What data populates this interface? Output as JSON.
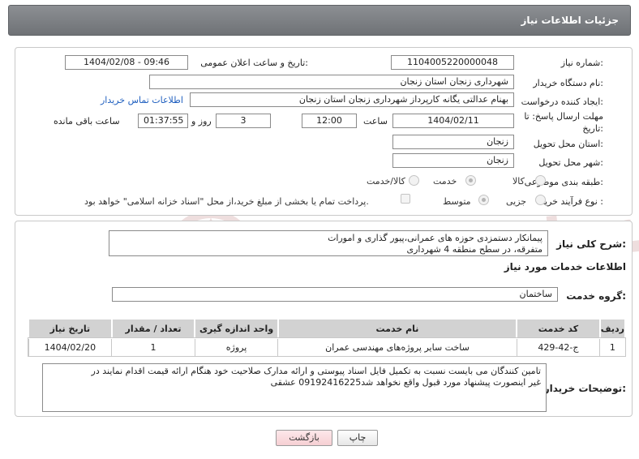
{
  "header": {
    "title": "جزئیات اطلاعات نیاز"
  },
  "watermark": {
    "brand_text": "AriaTender.neT",
    "color": "#8b1d1d"
  },
  "form": {
    "need_number": {
      "label": "شماره نیاز:",
      "value": "1104005220000048"
    },
    "announce_datetime": {
      "label": "تاریخ و ساعت اعلان عمومی:",
      "value": "1404/02/08 - 09:46"
    },
    "buyer_org": {
      "label": "نام دستگاه خریدار:",
      "value": "شهرداری زنجان استان زنجان"
    },
    "requester": {
      "label": "ایجاد کننده درخواست:",
      "value": "بهنام عدالتی یگانه کارپرداز شهرداری زنجان استان زنجان"
    },
    "contact_link": "اطلاعات تماس خریدار",
    "deadline": {
      "label_line1": "مهلت ارسال پاسخ: تا",
      "label_line2": "تاریخ:",
      "date": "1404/02/11",
      "time_label": "ساعت",
      "time": "12:00",
      "days": "3",
      "days_label": "روز و",
      "remaining": "01:37:55",
      "remaining_label": "ساعت باقی مانده"
    },
    "delivery_province": {
      "label": "استان محل تحویل:",
      "value": "زنجان"
    },
    "delivery_city": {
      "label": "شهر محل تحویل:",
      "value": "زنجان"
    },
    "category": {
      "label": "طبقه بندی موضوعی:",
      "options": [
        "کالا",
        "خدمت",
        "کالا/خدمت"
      ],
      "selected": "خدمت"
    },
    "process": {
      "label": "نوع فرآیند خرید :",
      "options": [
        "جزیی",
        "متوسط"
      ],
      "selected": "متوسط",
      "treasury_note": "پرداخت تمام یا بخشی از مبلغ خرید،از محل \"اسناد خزانه اسلامی\" خواهد بود."
    }
  },
  "details": {
    "summary": {
      "label": "شرح کلی نیاز:",
      "line1": "پیمانکار دستمزدی حوزه های عمرانی،پیور گذاری و امورات",
      "line2": "متفرقه، در سطح منطقه 4 شهرداری"
    },
    "services_heading": "اطلاعات خدمات مورد نیاز",
    "service_group": {
      "label": "گروه خدمت:",
      "value": "ساختمان"
    },
    "table": {
      "headers": [
        "ردیف",
        "کد خدمت",
        "نام خدمت",
        "واحد اندازه گیری",
        "تعداد / مقدار",
        "تاریخ نیاز"
      ],
      "rows": [
        [
          "1",
          "ج-42-429",
          "ساخت سایر پروژه‌های مهندسی عمران",
          "پروژه",
          "1",
          "1404/02/20"
        ]
      ]
    },
    "buyer_notes": {
      "label": "توضیحات خریدار:",
      "line1": "تامین کنندگان می بایست نسبت به تکمیل فایل اسناد پیوستی و ارائه مدارک صلاحیت خود هنگام ارائه قیمت اقدام نمایند در",
      "line2": "غیر اینصورت پیشنهاد مورد قبول واقع نخواهد شد09192416225 عشقی"
    }
  },
  "buttons": {
    "print": "چاپ",
    "back": "بازگشت"
  }
}
